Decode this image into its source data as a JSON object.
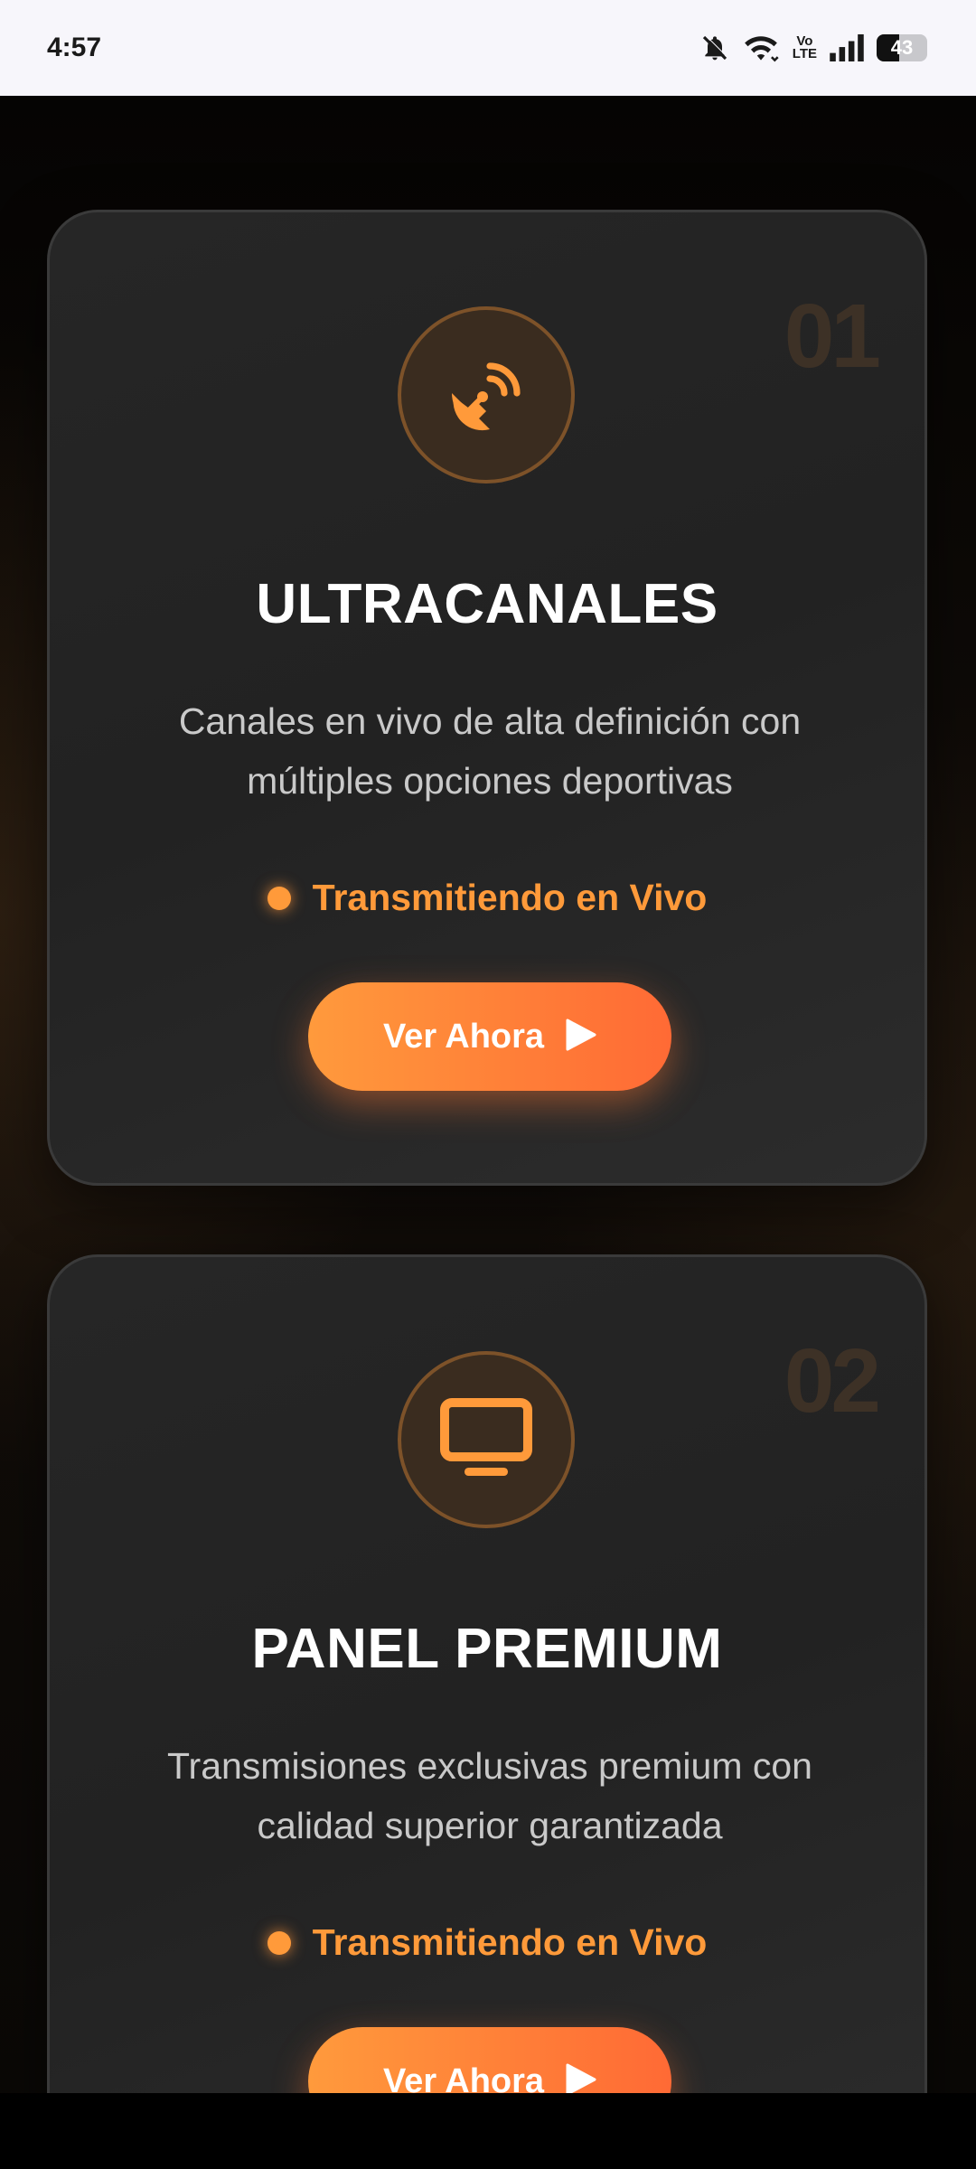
{
  "status_bar": {
    "time": "4:57",
    "volte": "Vo\nLTE",
    "battery_level": "43"
  },
  "cards": [
    {
      "number": "01",
      "icon": "satellite-dish-icon",
      "title": "ULTRACANALES",
      "description": "Canales en vivo de alta definición con múltiples opciones deportivas",
      "live_label": "Transmitiendo en Vivo",
      "button_label": "Ver Ahora"
    },
    {
      "number": "02",
      "icon": "tv-icon",
      "title": "PANEL PREMIUM",
      "description": "Transmisiones exclusivas premium con calidad superior garantizada",
      "live_label": "Transmitiendo en Vivo",
      "button_label": "Ver Ahora"
    }
  ],
  "colors": {
    "accent": "#ff9a3a",
    "button_start": "#ff9a3c",
    "button_end": "#ff6a35",
    "card_bg": "#262626",
    "status_bar_bg": "#f7f6fb"
  }
}
